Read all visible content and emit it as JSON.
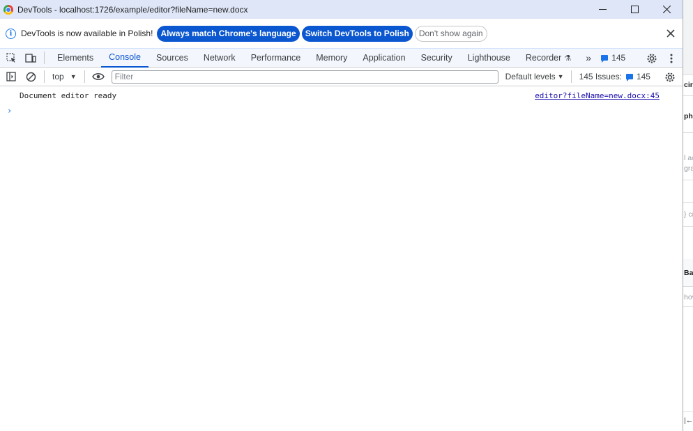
{
  "window": {
    "title": "DevTools - localhost:1726/example/editor?fileName=new.docx",
    "minimize_icon": "minimize-icon",
    "maximize_icon": "maximize-icon",
    "close_icon": "close-icon"
  },
  "infobar": {
    "message": "DevTools is now available in Polish!",
    "match_language_label": "Always match Chrome's language",
    "switch_language_label": "Switch DevTools to Polish",
    "dont_show_label": "Don't show again"
  },
  "tabs": {
    "items": [
      {
        "label": "Elements"
      },
      {
        "label": "Console"
      },
      {
        "label": "Sources"
      },
      {
        "label": "Network"
      },
      {
        "label": "Performance"
      },
      {
        "label": "Memory"
      },
      {
        "label": "Application"
      },
      {
        "label": "Security"
      },
      {
        "label": "Lighthouse"
      },
      {
        "label": "Recorder"
      }
    ],
    "active": "Console",
    "issues_count": "145"
  },
  "console_toolbar": {
    "context": "top",
    "filter_placeholder": "Filter",
    "filter_value": "",
    "levels_label": "Default levels",
    "issues_label": "145 Issues:",
    "issues_count": "145"
  },
  "console": {
    "messages": [
      {
        "text": "Document editor ready",
        "source": "editor?fileName=new.docx:45"
      }
    ]
  },
  "underlay": {
    "fragments": [
      "cir",
      "ph",
      "l ac",
      "gra",
      "} cr",
      "Ba",
      "hov",
      "|←"
    ]
  },
  "colors": {
    "accent": "#0b57d0",
    "titlebar_bg": "#dee6f7",
    "link": "#1a0dab"
  }
}
